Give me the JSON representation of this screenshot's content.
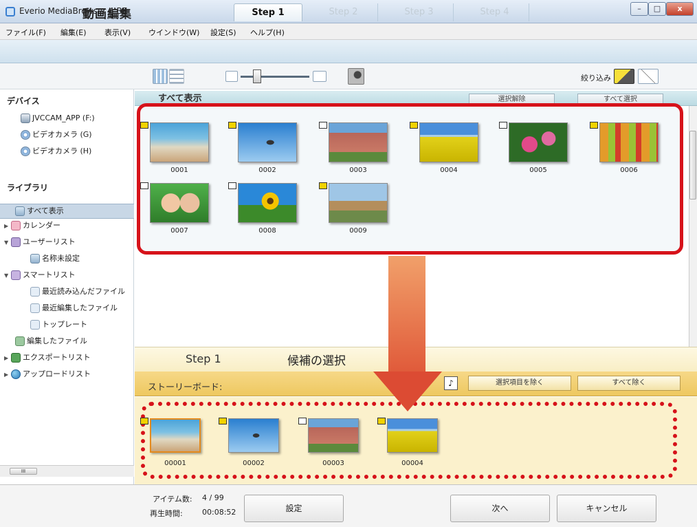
{
  "window": {
    "title": "Everio MediaBrowser 4 BE",
    "minimize_label": "–",
    "maximize_label": "□",
    "close_label": "x"
  },
  "menu": [
    "ファイル(F)",
    "編集(E)",
    "表示(V)",
    "ウインドウ(W)",
    "設定(S)",
    "ヘルプ(H)"
  ],
  "mode": {
    "title": "動画編集",
    "steps": [
      "Step 1",
      "Step 2",
      "Step 3",
      "Step 4"
    ],
    "active_step": "Step 1"
  },
  "toolbar": {
    "filter_label": "絞り込み"
  },
  "sidebar": {
    "devices_heading": "デバイス",
    "devices": [
      "JVCCAM_APP (F:)",
      "ビデオカメラ (G)",
      "ビデオカメラ (H)"
    ],
    "library_heading": "ライブラリ",
    "library_items": [
      {
        "label": "すべて表示",
        "selected": true
      },
      {
        "label": "カレンダー"
      },
      {
        "label": "ユーザーリスト"
      },
      {
        "label": "名称未設定"
      },
      {
        "label": "スマートリスト"
      },
      {
        "label": "最近読み込んだファイル"
      },
      {
        "label": "最近編集したファイル"
      },
      {
        "label": "トップレート"
      },
      {
        "label": "編集したファイル"
      },
      {
        "label": "エクスポートリスト"
      },
      {
        "label": "アップロードリスト"
      }
    ],
    "scroll_label": "III"
  },
  "content": {
    "title": "すべて表示",
    "deselect_label": "選択解除",
    "select_all_label": "すべて選択",
    "thumbnails": [
      {
        "id": "0001",
        "badge": "yellow"
      },
      {
        "id": "0002",
        "badge": "yellow"
      },
      {
        "id": "0003",
        "badge": "white"
      },
      {
        "id": "0004",
        "badge": "yellow"
      },
      {
        "id": "0005",
        "badge": "white"
      },
      {
        "id": "0006",
        "badge": "yellow"
      },
      {
        "id": "0007",
        "badge": "white"
      },
      {
        "id": "0008",
        "badge": "white"
      },
      {
        "id": "0009",
        "badge": "yellow"
      }
    ]
  },
  "storyboard": {
    "step_label": "Step 1",
    "step_name": "候補の選択",
    "label": "ストーリーボード:",
    "tool_glyph": "♪",
    "remove_selected_label": "選択項目を除く",
    "remove_all_label": "すべて除く",
    "items": [
      {
        "id": "00001",
        "badge": "yellow"
      },
      {
        "id": "00002",
        "badge": "yellow"
      },
      {
        "id": "00003",
        "badge": "white"
      },
      {
        "id": "00004",
        "badge": "yellow"
      }
    ]
  },
  "footer": {
    "items_label": "アイテム数:",
    "items_value": "4 / 99",
    "time_label": "再生時間:",
    "time_value": "00:08:52",
    "settings_label": "設定",
    "next_label": "次へ",
    "cancel_label": "キャンセル"
  },
  "colors": {
    "highlight_red": "#d6121a",
    "storyboard_bg": "#fbf1cc",
    "selection_blue": "#c8d7e6"
  }
}
